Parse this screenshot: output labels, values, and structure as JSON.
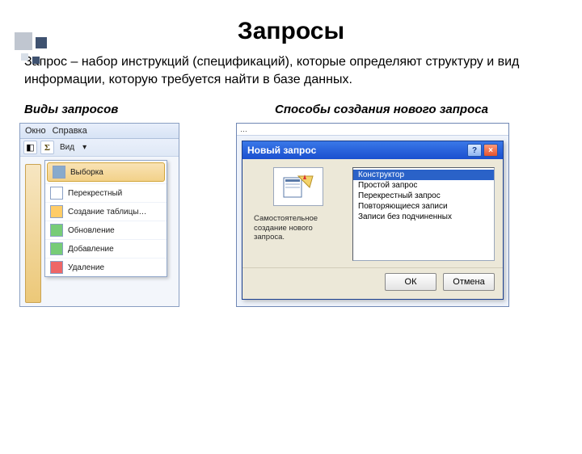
{
  "title": "Запросы",
  "definition": "Запрос – набор инструкций (спецификаций), которые определяют структуру и вид информации, которую требуется найти в базе данных.",
  "subhead_left": "Виды запросов",
  "subhead_right": "Способы создания нового запроса",
  "left": {
    "menu1": "Окно",
    "menu2": "Справка",
    "tool_view": "Вид",
    "items": [
      "Выборка",
      "Перекрестный",
      "Создание таблицы…",
      "Обновление",
      "Добавление",
      "Удаление"
    ]
  },
  "dialog": {
    "topbar_hint": "…",
    "title": "Новый запрос",
    "desc": "Самостоятельное создание нового запроса.",
    "list": [
      "Конструктор",
      "Простой запрос",
      "Перекрестный запрос",
      "Повторяющиеся записи",
      "Записи без подчиненных"
    ],
    "ok": "ОК",
    "cancel": "Отмена"
  }
}
